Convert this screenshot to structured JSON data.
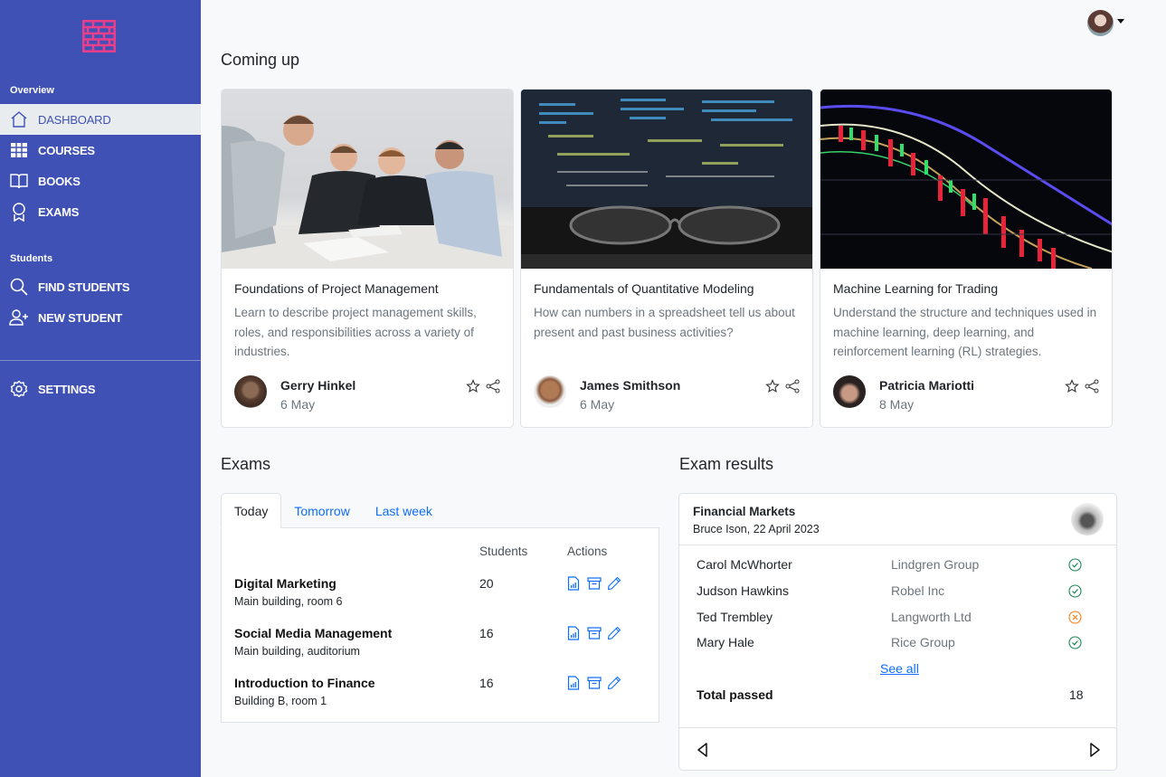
{
  "sidebar": {
    "logo_icon": "brick-wall-icon",
    "sections": [
      {
        "label": "Overview"
      },
      {
        "label": "Students"
      }
    ],
    "items": [
      {
        "label": "DASHBOARD",
        "icon": "home-icon",
        "active": true
      },
      {
        "label": "COURSES",
        "icon": "table-icon"
      },
      {
        "label": "BOOKS",
        "icon": "book-icon"
      },
      {
        "label": "EXAMS",
        "icon": "award-icon"
      },
      {
        "label": "FIND STUDENTS",
        "icon": "search-icon"
      },
      {
        "label": "NEW STUDENT",
        "icon": "person-add-icon"
      },
      {
        "label": "SETTINGS",
        "icon": "gear-icon"
      }
    ]
  },
  "header": {
    "user_avatar": "user-avatar",
    "menu_caret": "caret-down-icon"
  },
  "coming_up": {
    "title": "Coming up",
    "cards": [
      {
        "title": "Foundations of Project Management",
        "description": "Learn to describe project management skills, roles, and responsibilities across a variety of industries.",
        "author": "Gerry Hinkel",
        "date": "6 May",
        "image": "business-meeting-photo"
      },
      {
        "title": "Fundamentals of Quantitative Modeling",
        "description": "How can numbers in a spreadsheet tell us about present and past business activities?",
        "author": "James Smithson",
        "date": "6 May",
        "image": "monitor-code-glasses-photo"
      },
      {
        "title": "Machine Learning for Trading",
        "description": "Understand the structure and techniques used in machine learning, deep learning, and reinforcement learning (RL) strategies.",
        "author": "Patricia Mariotti",
        "date": "8 May",
        "image": "stock-candlestick-photo"
      }
    ]
  },
  "exams": {
    "title": "Exams",
    "tabs": [
      {
        "label": "Today",
        "active": true
      },
      {
        "label": "Tomorrow"
      },
      {
        "label": "Last week"
      }
    ],
    "columns": {
      "students": "Students",
      "actions": "Actions"
    },
    "rows": [
      {
        "name": "Digital Marketing",
        "location": "Main building, room 6",
        "students": "20"
      },
      {
        "name": "Social Media Management",
        "location": "Main building, auditorium",
        "students": "16"
      },
      {
        "name": "Introduction to Finance",
        "location": "Building B, room 1",
        "students": "16"
      }
    ],
    "action_icons": [
      "report-icon",
      "archive-icon",
      "edit-icon"
    ]
  },
  "exam_results": {
    "title": "Exam results",
    "course": "Financial Markets",
    "subtitle": "Bruce Ison, 22 April 2023",
    "rows": [
      {
        "student": "Carol McWhorter",
        "company": "Lindgren Group",
        "status": "passed"
      },
      {
        "student": "Judson Hawkins",
        "company": "Robel Inc",
        "status": "passed"
      },
      {
        "student": "Ted Trembley",
        "company": "Langworth Ltd",
        "status": "failed"
      },
      {
        "student": "Mary Hale",
        "company": "Rice Group",
        "status": "passed"
      }
    ],
    "see_all": "See all",
    "total_label": "Total passed",
    "total_value": "18",
    "colors": {
      "passed": "#198754",
      "failed": "#fd7e14"
    }
  },
  "colors": {
    "sidebar_bg": "#3f51b5",
    "accent": "#0d6efd",
    "logo": "#e83e8c"
  }
}
